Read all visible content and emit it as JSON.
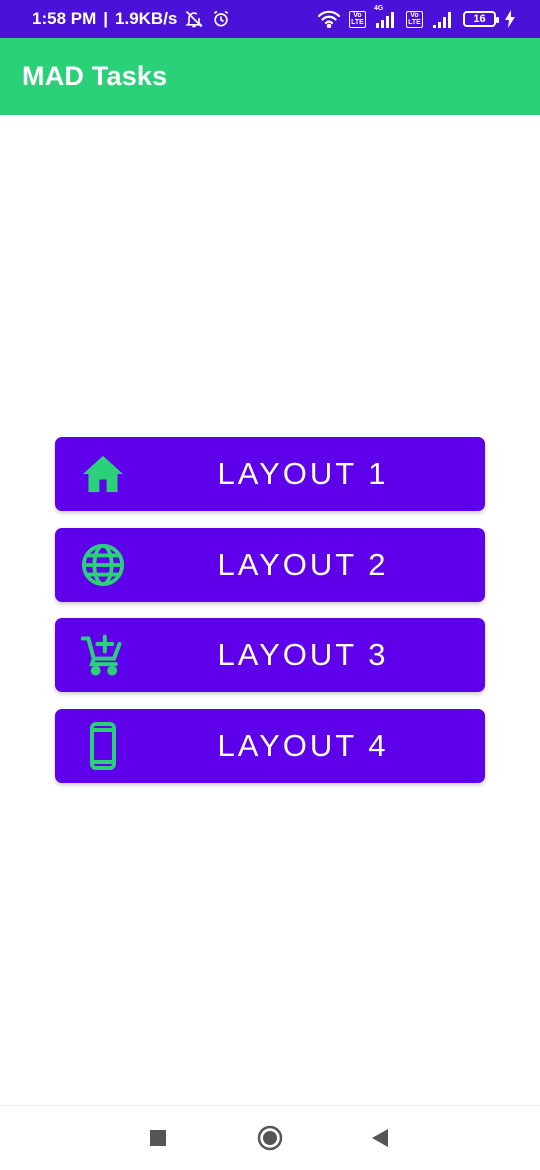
{
  "status_bar": {
    "time": "1:58 PM",
    "separator": "|",
    "speed": "1.9KB/s",
    "tag1_top": "Vo",
    "tag1_bottom": "LTE",
    "net_label": "4G",
    "tag2_top": "Vo",
    "tag2_bottom": "LTE",
    "battery": "16"
  },
  "app_bar": {
    "title": "MAD Tasks"
  },
  "buttons": [
    {
      "label": "LAYOUT 1",
      "icon": "home-icon"
    },
    {
      "label": "LAYOUT 2",
      "icon": "globe-icon"
    },
    {
      "label": "LAYOUT 3",
      "icon": "add-shopping-cart-icon"
    },
    {
      "label": "LAYOUT 4",
      "icon": "smartphone-icon"
    }
  ],
  "colors": {
    "status_bar": "#4a12d8",
    "app_bar": "#2ad178",
    "button": "#5f00ea",
    "icon": "#2ad178"
  },
  "nav_bar": {
    "icons": [
      "recents-square-icon",
      "home-circle-icon",
      "back-triangle-icon"
    ]
  }
}
